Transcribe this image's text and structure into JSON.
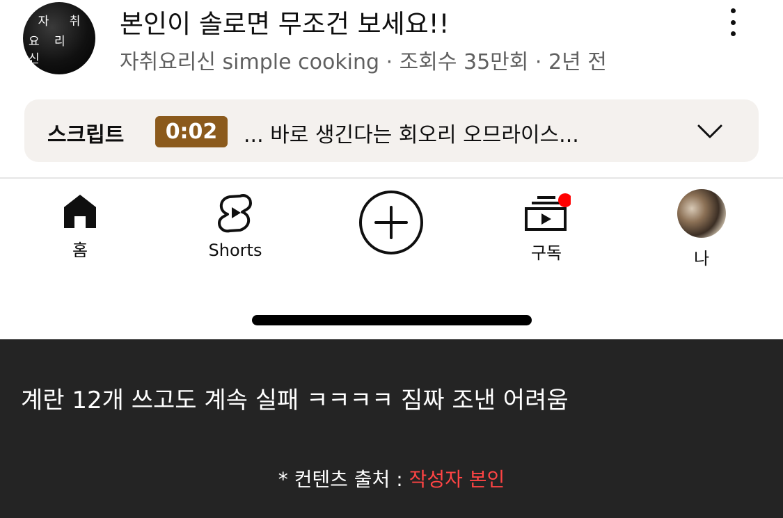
{
  "video": {
    "channel_avatar_line1": "자 취",
    "channel_avatar_line2": "요 리 신",
    "title": "본인이 솔로면 무조건 보세요!!",
    "meta": "자취요리신 simple cooking · 조회수 35만회 · 2년 전",
    "more_icon": "more-vert-icon"
  },
  "transcript": {
    "label": "스크립트",
    "timestamp": "0:02",
    "line": "... 바로 생긴다는 회오리 오므라이스...",
    "expand_icon": "chevron-down-icon",
    "timestamp_color": "#8b5a1c"
  },
  "bottom_nav": {
    "items": [
      {
        "label": "홈",
        "icon": "home-icon"
      },
      {
        "label": "Shorts",
        "icon": "shorts-icon"
      },
      {
        "label": "",
        "icon": "create-icon"
      },
      {
        "label": "구독",
        "icon": "subscriptions-icon"
      },
      {
        "label": "나",
        "icon": "profile-avatar"
      }
    ],
    "notification_dot_color": "#ff0000"
  },
  "caption": {
    "text": "계란 12개 쓰고도 계속 실패 ㅋㅋㅋㅋ 짐짜 조낸 어려움",
    "credit_prefix": "* 컨텐츠 출처 : ",
    "credit_author": "작성자 본인",
    "credit_author_color": "#ff4444"
  }
}
